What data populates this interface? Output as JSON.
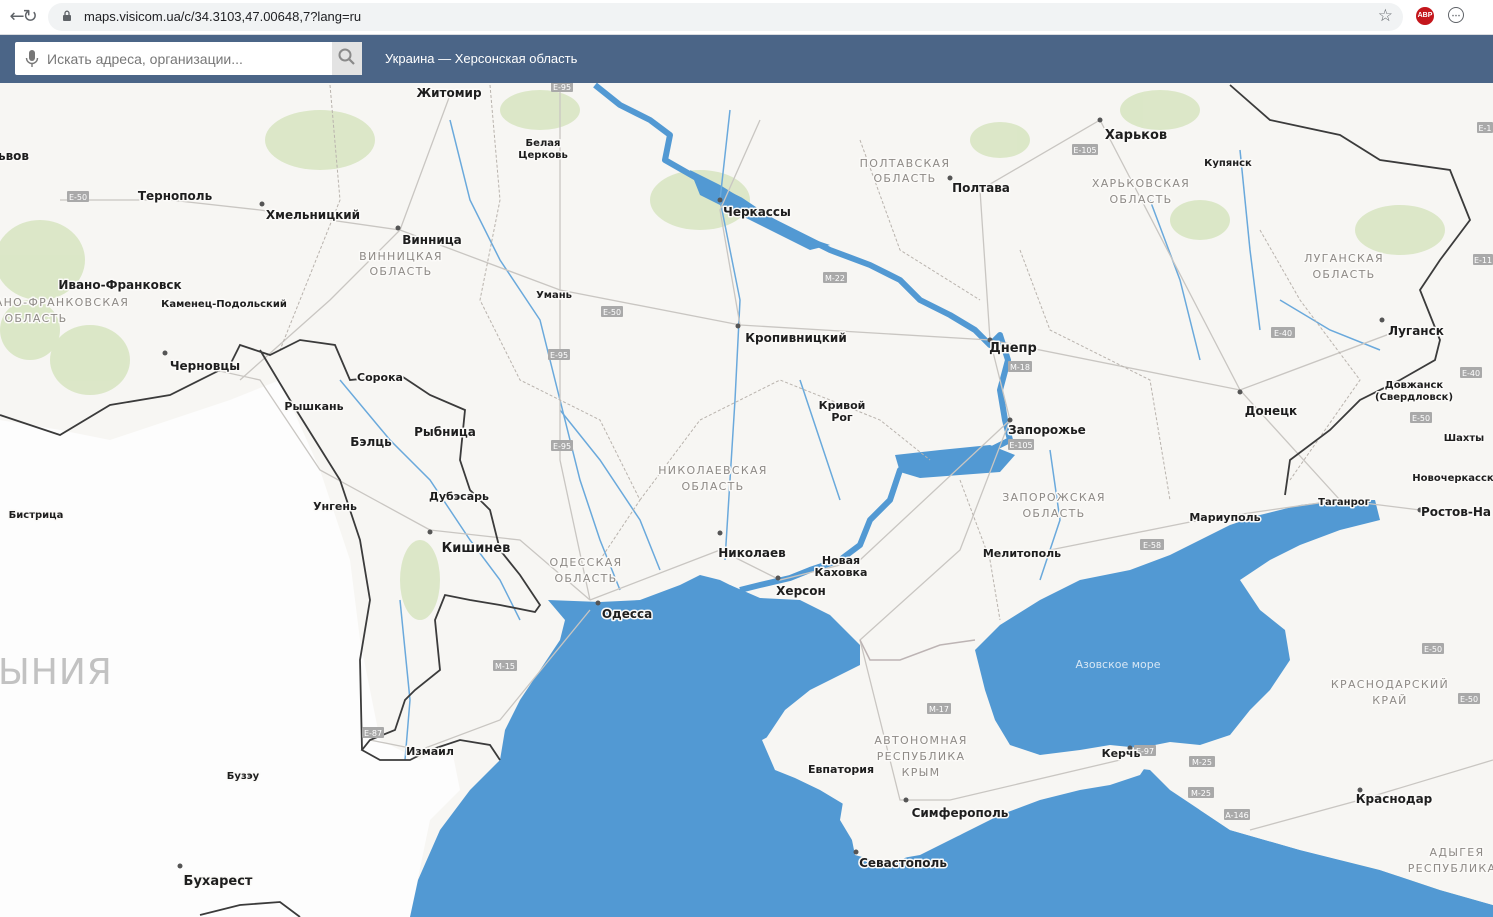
{
  "browser": {
    "url": "maps.visicom.ua/c/34.3103,47.00648,7?lang=ru",
    "icons": [
      "back-arrow-icon",
      "reload-icon",
      "lock-icon",
      "star-icon",
      "adblock-icon",
      "extension-icon"
    ],
    "adblock_label": "ABP"
  },
  "toolbar": {
    "search_placeholder": "Искать адреса, организации...",
    "region_title": "Украина — Херсонская область",
    "background": "#4b6587"
  },
  "map": {
    "sea_color": "#5299d3",
    "land_color": "#f7f6f3",
    "country_label": "ЫНИЯ",
    "sea_label": "Азовское море",
    "cities": {
      "zhitomir": "Житомир",
      "belaya": "Белая",
      "tserkov": "Церковь",
      "kharkov": "Харьков",
      "kupyansk": "Купянск",
      "lvov": "ьвов",
      "ternopol": "Тернополь",
      "khmelnitsky": "Хмельницкий",
      "cherkassy": "Черкассы",
      "poltava": "Полтава",
      "vinnitsa": "Винница",
      "ivano": "Ивано-Франковск",
      "kamenets": "Каменец-Подольский",
      "uman": "Умань",
      "kropyvnytskyi": "Кропивницкий",
      "lugansk": "Луганск",
      "chernovtsy": "Черновцы",
      "soroka": "Сорока",
      "dnepr": "Днепр",
      "dovzhansk": "Довжанск",
      "sverdlovsk": "(Свердловск)",
      "ryshkan": "Рышкань",
      "krivoy": "Кривой",
      "rog": "Рог",
      "donetsk": "Донецк",
      "zaporozhye": "Запорожье",
      "shakhty": "Шахты",
      "beltsy": "Бэлць",
      "rybnitsa": "Рыбница",
      "novocherkassk": "Новочеркасск",
      "dubossary": "Дубэсарь",
      "taganrog": "Таганрог",
      "ungeni": "Унгень",
      "bistrita": "Бистрица",
      "mariupol": "Мариуполь",
      "rostov": "Ростов-На",
      "kishinev": "Кишинев",
      "nikolaev": "Николаев",
      "melitopol": "Мелитополь",
      "nova": "Новая",
      "kakhovka": "Каховка",
      "kherson": "Херсон",
      "odessa": "Одесса",
      "izmail": "Измаил",
      "kerch": "Керчь",
      "evpatoriya": "Евпатория",
      "buzeu": "Бузэу",
      "krasnodar": "Краснодар",
      "simferopol": "Симферополь",
      "sevastopol": "Севастополь",
      "bukharest": "Бухарест"
    },
    "regions": {
      "poltavskaya_1": "ПОЛТАВСКАЯ",
      "poltavskaya_2": "ОБЛАСТЬ",
      "kharkovskaya_1": "ХАРЬКОВСКАЯ",
      "kharkovskaya_2": "ОБЛАСТЬ",
      "vinnitskaya_1": "ВИННИЦКАЯ",
      "vinnitskaya_2": "ОБЛАСТЬ",
      "luganskaya_1": "ЛУГАНСКАЯ",
      "luganskaya_2": "ОБЛАСТЬ",
      "frankovskaya_1": "АНО-ФРАНКОВСКАЯ",
      "frankovskaya_2": "ОБЛАСТЬ",
      "nikolaevskaya_1": "НИКОЛАЕВСКАЯ",
      "nikolaevskaya_2": "ОБЛАСТЬ",
      "zaporozhskaya_1": "ЗАПОРОЖСКАЯ",
      "zaporozhskaya_2": "ОБЛАСТЬ",
      "odesskaya_1": "ОДЕССКАЯ",
      "odesskaya_2": "ОБЛАСТЬ",
      "krasnodarsky_1": "КРАСНОДАРСКИЙ",
      "krasnodarsky_2": "КРАЙ",
      "krym_1": "АВТОНОМНАЯ",
      "krym_2": "РЕСПУБЛИКА",
      "krym_3": "КРЫМ",
      "adygeya_1": "АДЫГЕЯ",
      "adygeya_2": "РЕСПУБЛИКА"
    },
    "highways": [
      "E-95",
      "E-105",
      "E-50",
      "E-95",
      "E-50",
      "M-22",
      "E-40",
      "E-95",
      "M-18",
      "E-40",
      "E-105",
      "E-50",
      "E-58",
      "M-15",
      "M-17",
      "E-87",
      "E-97",
      "M-25",
      "M-25",
      "A-146",
      "E-50",
      "E-50",
      "E-11",
      "E-1"
    ]
  }
}
